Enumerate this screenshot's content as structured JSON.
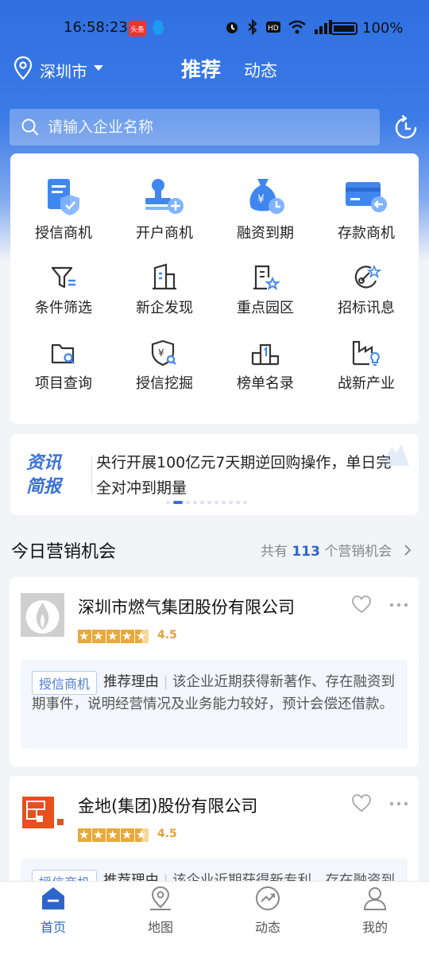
{
  "status_bar": {
    "time": "16:58:23",
    "app_badge": "头条",
    "battery": "100%"
  },
  "header": {
    "city": "深圳市",
    "tab_recommend": "推荐",
    "tab_dynamic": "动态"
  },
  "search": {
    "placeholder": "请输入企业名称"
  },
  "grid": [
    {
      "label": "授信商机",
      "icon": "credit-card-shield-icon"
    },
    {
      "label": "开户商机",
      "icon": "open-account-stamp-icon"
    },
    {
      "label": "融资到期",
      "icon": "money-bag-clock-icon"
    },
    {
      "label": "存款商机",
      "icon": "deposit-card-icon"
    },
    {
      "label": "条件筛选",
      "icon": "filter-icon"
    },
    {
      "label": "新企发现",
      "icon": "new-building-icon"
    },
    {
      "label": "重点园区",
      "icon": "park-star-icon"
    },
    {
      "label": "招标讯息",
      "icon": "bid-announcement-icon"
    },
    {
      "label": "项目查询",
      "icon": "folder-search-icon"
    },
    {
      "label": "授信挖掘",
      "icon": "shield-yen-search-icon"
    },
    {
      "label": "榜单名录",
      "icon": "ranking-podium-icon"
    },
    {
      "label": "战新产业",
      "icon": "industry-factory-icon"
    }
  ],
  "news": {
    "logo_line1": "资讯",
    "logo_line2": "简报",
    "text": "央行开展100亿元7天期逆回购操作，单日完全对冲到期量"
  },
  "section": {
    "title": "今日营销机会",
    "more_prefix": "共有",
    "count": "113",
    "more_suffix": "个营销机会"
  },
  "companies": [
    {
      "name": "深圳市燃气集团股份有限公司",
      "rating": "4.5",
      "tag": "授信商机",
      "reason_label": "推荐理由",
      "reason": "该企业近期获得新著作、存在融资到期事件，说明经营情况及业务能力较好，预计会偿还借款。"
    },
    {
      "name": "金地(集团)股份有限公司",
      "rating": "4.5",
      "tag": "授信商机",
      "reason_label": "推荐理由",
      "reason": "该企业近期获得新专利、存在融资到期事件"
    }
  ],
  "bottom_nav": [
    {
      "label": "首页",
      "icon": "home-icon",
      "active": true
    },
    {
      "label": "地图",
      "icon": "map-pin-icon",
      "active": false
    },
    {
      "label": "动态",
      "icon": "trend-icon",
      "active": false
    },
    {
      "label": "我的",
      "icon": "user-icon",
      "active": false
    }
  ],
  "colors": {
    "primary": "#2d66c8",
    "header_blue": "#2f6fe0",
    "star": "#e9a93a",
    "gas_logo_bg": "#cfcfcf",
    "gemdale_orange": "#e8501e"
  }
}
